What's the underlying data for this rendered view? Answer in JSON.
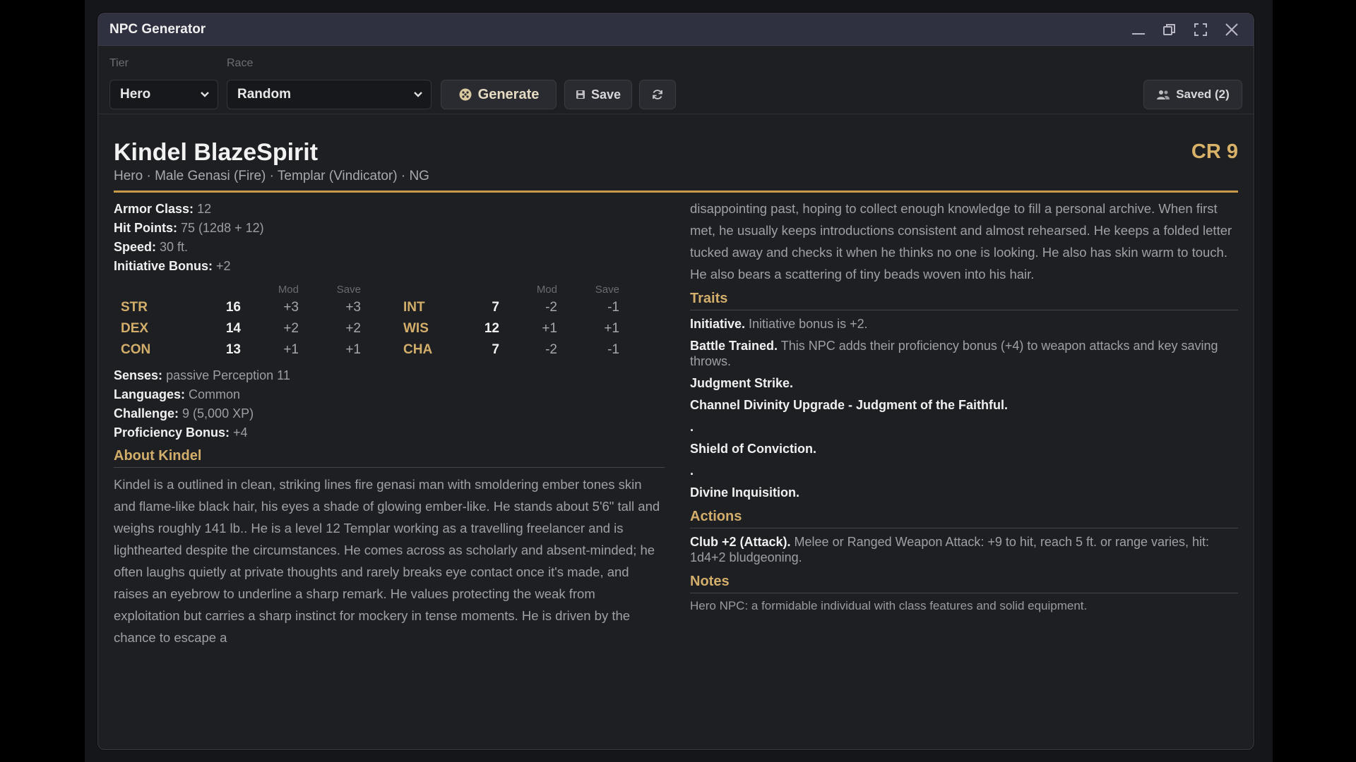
{
  "window": {
    "title": "NPC Generator"
  },
  "toolbar": {
    "tier_label": "Tier",
    "tier_value": "Hero",
    "race_label": "Race",
    "race_value": "Random",
    "generate_label": "Generate",
    "save_label": "Save",
    "saved_label": "Saved (2)"
  },
  "npc": {
    "name": "Kindel BlazeSpirit",
    "subtitle": "Hero · Male Genasi (Fire) · Templar (Vindicator) · NG",
    "cr": "CR 9",
    "stats": [
      {
        "label": "Armor Class:",
        "value": "12"
      },
      {
        "label": "Hit Points:",
        "value": "75 (12d8 + 12)"
      },
      {
        "label": "Speed:",
        "value": "30 ft."
      },
      {
        "label": "Initiative Bonus:",
        "value": "+2"
      }
    ],
    "ability_headers": {
      "mod": "Mod",
      "save": "Save"
    },
    "abilities_left": [
      {
        "name": "STR",
        "score": "16",
        "mod": "+3",
        "save": "+3"
      },
      {
        "name": "DEX",
        "score": "14",
        "mod": "+2",
        "save": "+2"
      },
      {
        "name": "CON",
        "score": "13",
        "mod": "+1",
        "save": "+1"
      }
    ],
    "abilities_right": [
      {
        "name": "INT",
        "score": "7",
        "mod": "-2",
        "save": "-1"
      },
      {
        "name": "WIS",
        "score": "12",
        "mod": "+1",
        "save": "+1"
      },
      {
        "name": "CHA",
        "score": "7",
        "mod": "-2",
        "save": "-1"
      }
    ],
    "details": [
      {
        "label": "Senses:",
        "value": "passive Perception 11"
      },
      {
        "label": "Languages:",
        "value": "Common"
      },
      {
        "label": "Challenge:",
        "value": "9 (5,000 XP)"
      },
      {
        "label": "Proficiency Bonus:",
        "value": "+4"
      }
    ],
    "about_heading": "About Kindel",
    "about_text": "Kindel is a outlined in clean, striking lines fire genasi man with smoldering ember tones skin and flame-like black hair, his eyes a shade of glowing ember-like. He stands about 5'6\" tall and weighs roughly 141 lb.. He is a level 12 Templar working as a travelling freelancer and is lighthearted despite the circumstances. He comes across as scholarly and absent-minded; he often laughs quietly at private thoughts and rarely breaks eye contact once it's made, and raises an eyebrow to underline a sharp remark. He values protecting the weak from exploitation but carries a sharp instinct for mockery in tense moments. He is driven by the chance to escape a",
    "about_continued": "disappointing past, hoping to collect enough knowledge to fill a personal archive. When first met, he usually keeps introductions consistent and almost rehearsed. He keeps a folded letter tucked away and checks it when he thinks no one is looking. He also has skin warm to touch. He also bears a scattering of tiny beads woven into his hair.",
    "traits_heading": "Traits",
    "traits": [
      {
        "name": "Initiative.",
        "text": "Initiative bonus is +2."
      },
      {
        "name": "Battle Trained.",
        "text": "This NPC adds their proficiency bonus (+4) to weapon attacks and key saving throws."
      },
      {
        "name": "Judgment Strike.",
        "text": ""
      },
      {
        "name": "Channel Divinity Upgrade - Judgment of the Faithful.",
        "text": ""
      },
      {
        "name": "",
        "text": "."
      },
      {
        "name": "Shield of Conviction.",
        "text": ""
      },
      {
        "name": "",
        "text": "."
      },
      {
        "name": "Divine Inquisition.",
        "text": ""
      }
    ],
    "actions_heading": "Actions",
    "actions": [
      {
        "name": "Club +2 (Attack).",
        "text": "Melee or Ranged Weapon Attack: +9 to hit, reach 5 ft. or range varies, hit: 1d4+2 bludgeoning."
      }
    ],
    "notes_heading": "Notes",
    "notes_text": "Hero NPC: a formidable individual with class features and solid equipment."
  },
  "colors": {
    "accent_gold": "#d3ae6b",
    "title_bar": "#2f3040",
    "panel": "#1e1f23"
  }
}
